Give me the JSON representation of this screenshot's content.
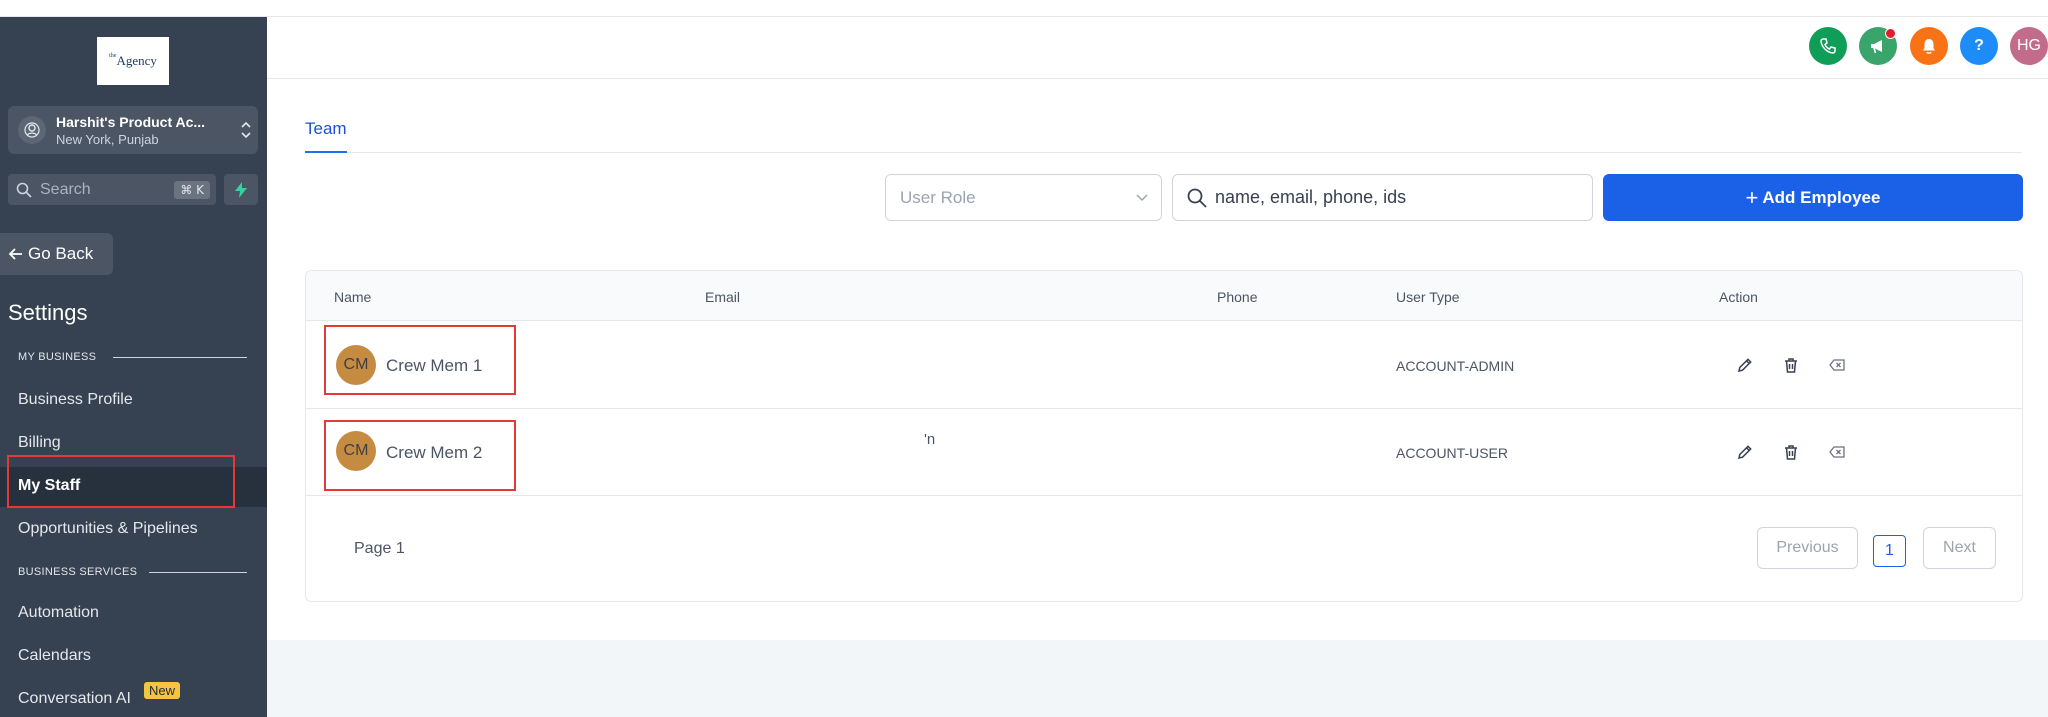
{
  "sidebar": {
    "logo_text": "Agency",
    "logo_sup": "the",
    "account": {
      "name": "Harshit's Product Ac...",
      "location": "New York, Punjab"
    },
    "search": {
      "placeholder": "Search",
      "shortcut": "⌘ K"
    },
    "go_back": "Go Back",
    "title": "Settings",
    "sections": [
      {
        "label": "MY BUSINESS",
        "items": [
          "Business Profile",
          "Billing",
          "My Staff",
          "Opportunities & Pipelines"
        ]
      },
      {
        "label": "BUSINESS SERVICES",
        "items": [
          "Automation",
          "Calendars",
          "Conversation AI"
        ]
      }
    ],
    "active_item": "My Staff",
    "new_badge": "New"
  },
  "header": {
    "buttons": [
      {
        "name": "phone-icon",
        "color": "#0f9d58"
      },
      {
        "name": "megaphone-icon",
        "color": "#3aa56a"
      },
      {
        "name": "bell-icon",
        "color": "#f97316"
      },
      {
        "name": "help-icon",
        "color": "#1d8cf8",
        "label": "?"
      },
      {
        "name": "user-avatar",
        "color": "#c26b8b",
        "label": "HG"
      }
    ]
  },
  "main": {
    "tab": "Team",
    "filters": {
      "role_placeholder": "User Role",
      "search_placeholder": "name, email, phone, ids",
      "add_button": "Add Employee"
    },
    "table": {
      "columns": [
        "Name",
        "Email",
        "Phone",
        "User Type",
        "Action"
      ],
      "rows": [
        {
          "initials": "CM",
          "name": "Crew Mem 1",
          "email": "",
          "phone": "",
          "user_type": "ACCOUNT-ADMIN"
        },
        {
          "initials": "CM",
          "name": "Crew Mem 2",
          "email": "",
          "phone": "",
          "user_type": "ACCOUNT-USER"
        }
      ],
      "stray_text": "'n"
    },
    "pagination": {
      "page_label": "Page 1",
      "previous": "Previous",
      "current": "1",
      "next": "Next"
    }
  },
  "colors": {
    "accent": "#1a61e8",
    "sidebar_bg": "#364152",
    "highlight": "#e53935",
    "avatar": "#c58b41"
  }
}
